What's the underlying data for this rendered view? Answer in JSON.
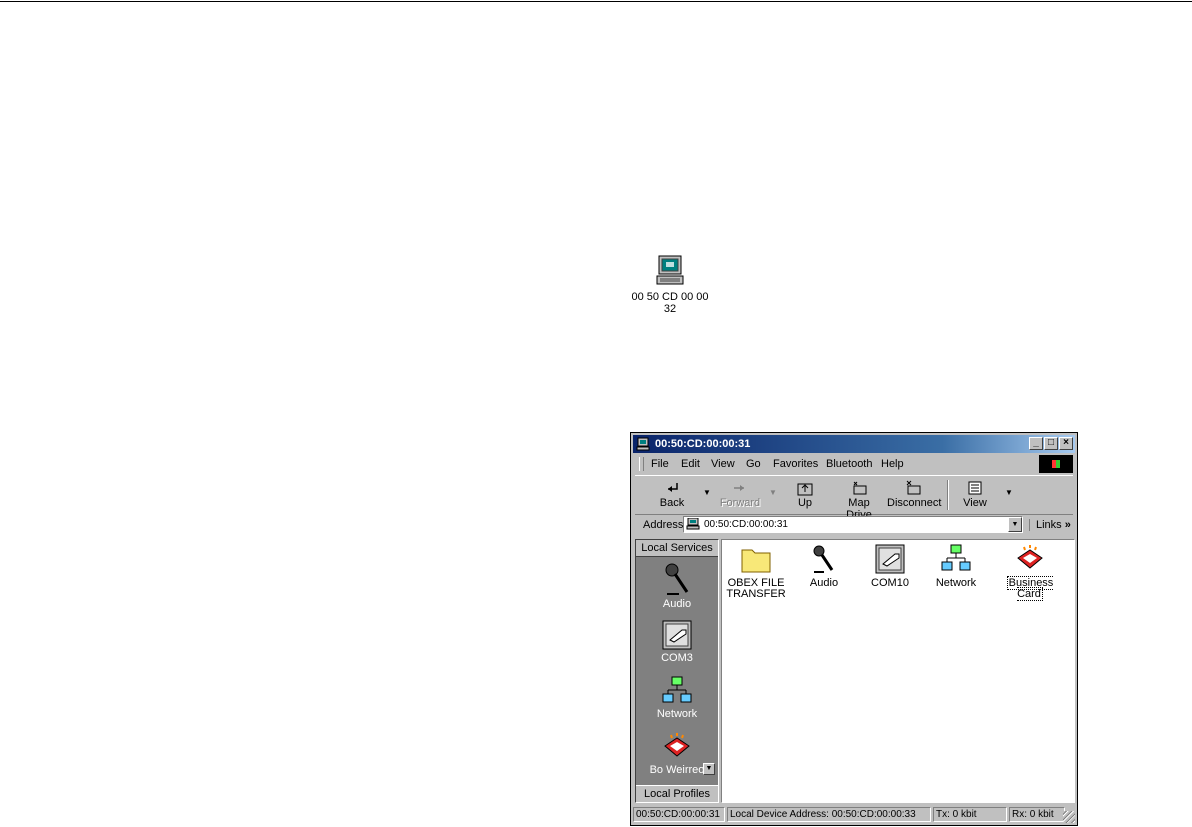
{
  "desktop": {
    "device_label": "00 50 CD 00 00 32"
  },
  "window": {
    "title": "00:50:CD:00:00:31",
    "menu": [
      "File",
      "Edit",
      "View",
      "Go",
      "Favorites",
      "Bluetooth",
      "Help"
    ],
    "toolbar": {
      "back": "Back",
      "forward": "Forward",
      "up": "Up",
      "map_drive": "Map Drive",
      "disconnect": "Disconnect",
      "view": "View"
    },
    "address": {
      "label": "Address",
      "value": "00:50:CD:00:00:31",
      "links": "Links"
    },
    "sidebar": {
      "header": "Local Services",
      "footer": "Local Profiles",
      "items": [
        "Audio",
        "COM3",
        "Network",
        "Bo Weirreo"
      ]
    },
    "content": {
      "items": [
        {
          "label": "OBEX FILE TRANSFER",
          "icon": "folder-icon"
        },
        {
          "label": "Audio",
          "icon": "microphone-icon"
        },
        {
          "label": "COM10",
          "icon": "serial-port-icon"
        },
        {
          "label": "Network",
          "icon": "network-icon"
        },
        {
          "label": "Business Card",
          "icon": "business-card-icon"
        }
      ]
    },
    "status": {
      "device": "00:50:CD:00:00:31",
      "local_address": "Local Device Address: 00:50:CD:00:00:33",
      "tx": "Tx:  0 kbit",
      "rx": "Rx:  0 kbit"
    }
  }
}
